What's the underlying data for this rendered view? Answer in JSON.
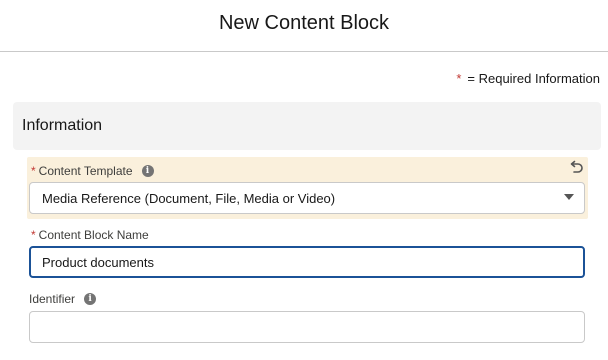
{
  "modal": {
    "title": "New Content Block"
  },
  "legend": {
    "asterisk": "*",
    "text": "= Required Information"
  },
  "section": {
    "title": "Information"
  },
  "fields": {
    "content_template": {
      "label": "Content Template",
      "required_mark": "*",
      "info_icon": "i",
      "value": "Media Reference (Document, File, Media or Video)"
    },
    "content_block_name": {
      "label": "Content Block Name",
      "required_mark": "*",
      "value": "Product documents"
    },
    "identifier": {
      "label": "Identifier",
      "info_icon": "i",
      "value": ""
    }
  },
  "icons": {
    "info": "info-icon",
    "undo": "undo-icon",
    "chevron": "chevron-down-icon"
  },
  "colors": {
    "required": "#c23934",
    "focus_border": "#1b5297",
    "edited_highlight": "#faf0dc",
    "section_bg": "#f3f3f3"
  }
}
